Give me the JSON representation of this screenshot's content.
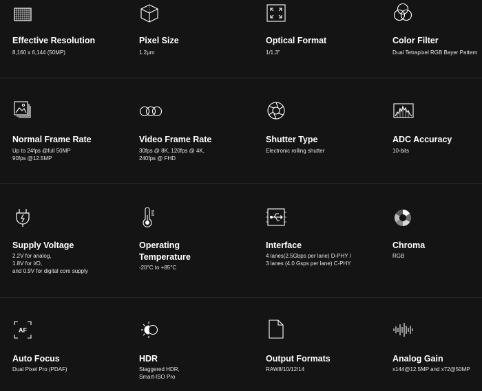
{
  "specs": [
    {
      "title": "Effective Resolution",
      "value": "8,160 x 6,144 (50MP)",
      "icon": "grid-icon"
    },
    {
      "title": "Pixel Size",
      "value": "1.2μm",
      "icon": "cube-icon"
    },
    {
      "title": "Optical Format",
      "value": "1/1.3\"",
      "icon": "expand-frame-icon"
    },
    {
      "title": "Color Filter",
      "value": "Dual Tetrapixel RGB Bayer Pattern",
      "icon": "rgb-circles-icon"
    },
    {
      "title": "Normal Frame Rate",
      "value": "Up to 24fps @full 50MP\n90fps @12.5MP",
      "icon": "image-stack-icon"
    },
    {
      "title": "Video Frame Rate",
      "value": "30fps @ 8K, 120fps @ 4K,\n240fps @ FHD",
      "icon": "film-circles-icon"
    },
    {
      "title": "Shutter Type",
      "value": "Electronic rolling shutter",
      "icon": "aperture-icon"
    },
    {
      "title": "ADC Accuracy",
      "value": "10-bits",
      "icon": "histogram-icon"
    },
    {
      "title": "Supply Voltage",
      "value": "2.2V for analog,\n1.8V for I/O,\nand 0.9V for digital core supply",
      "icon": "power-plug-icon"
    },
    {
      "title": "Operating\nTemperature",
      "value": "-20°C to +85°C",
      "icon": "thermometer-icon"
    },
    {
      "title": "Interface",
      "value": "4 lanes(2.5Gbps per lane) D-PHY /\n3 lanes (4.0 Gsps per lane) C-PHY",
      "icon": "usb-frame-icon"
    },
    {
      "title": "Chroma",
      "value": "RGB",
      "icon": "color-wheel-icon"
    },
    {
      "title": "Auto Focus",
      "value": "Dual Pixel Pro (PDAF)",
      "icon": "autofocus-icon",
      "icon_text": "AF"
    },
    {
      "title": "HDR",
      "value": "Staggered HDR,\nSmart-ISO Pro",
      "icon": "hdr-sun-icon"
    },
    {
      "title": "Output Formats",
      "value": "RAW8/10/12/14",
      "icon": "document-icon"
    },
    {
      "title": "Analog Gain",
      "value": "x144@12.5MP and x72@50MP",
      "icon": "waveform-icon"
    }
  ]
}
